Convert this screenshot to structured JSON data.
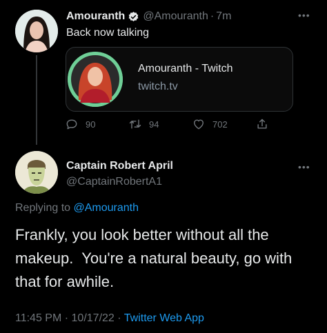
{
  "tweet1": {
    "name": "Amouranth",
    "handle": "@Amouranth",
    "sep": "·",
    "time": "7m",
    "text": "Back now talking",
    "card": {
      "title": "Amouranth - Twitch",
      "domain": "twitch.tv"
    },
    "actions": {
      "replies": "90",
      "retweets": "94",
      "likes": "702"
    }
  },
  "tweet2": {
    "name": "Captain Robert April",
    "handle": "@CaptainRobertA1",
    "replying_prefix": "Replying to",
    "replying_to": "@Amouranth",
    "text": "Frankly, you look better without all the makeup.  You're a natural beauty, go with that for awhile.",
    "time": "11:45 PM",
    "date": "10/17/22",
    "sep": "·",
    "source": "Twitter Web App"
  },
  "colors": {
    "link": "#1d9bf0",
    "muted": "#71767b",
    "verified": "#e7e9ea",
    "card_ring": "#6fcf97"
  }
}
